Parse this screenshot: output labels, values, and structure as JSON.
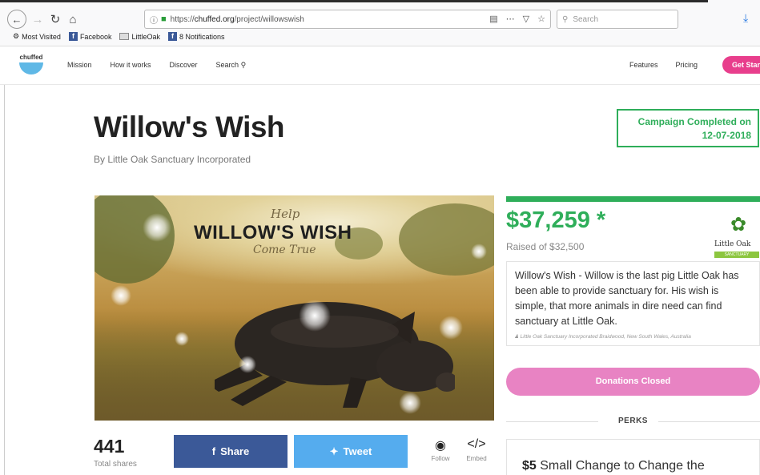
{
  "browser": {
    "url_protocol": "https://",
    "url_host": "chuffed.org",
    "url_path": "/project/willowswish",
    "search_placeholder": "Search",
    "bookmarks": [
      {
        "label": "Most Visited",
        "icon": "gear-icon"
      },
      {
        "label": "Facebook",
        "icon": "facebook-icon"
      },
      {
        "label": "LittleOak",
        "icon": "folder-icon"
      },
      {
        "label": "8 Notifications",
        "icon": "facebook-icon"
      }
    ]
  },
  "site_nav": {
    "logo_text": "chuffed",
    "links": [
      "Mission",
      "How it works",
      "Discover",
      "Search"
    ],
    "right_links": [
      "Features",
      "Pricing"
    ],
    "cta": "Get Start"
  },
  "campaign": {
    "title": "Willow's Wish",
    "byline": "By Little Oak Sanctuary Incorporated",
    "status_line1": "Campaign Completed on",
    "status_line2": "12-07-2018",
    "hero_help": "Help",
    "hero_title": "WILLOW'S WISH",
    "hero_sub": "Come True",
    "raised": "$37,259 *",
    "target": "Raised of $32,500",
    "progress": 1.0,
    "org_logo_name": "Little Oak",
    "org_logo_band": "SANCTUARY",
    "description": "Willow's Wish - Willow is the last pig Little Oak has been able to provide sanctuary for. His wish is simple, that more animals in dire need can find sanctuary at Little Oak.",
    "meta": "Little Oak Sanctuary Incorporated  Braidwood, New South Wales, Australia",
    "donate_label": "Donations Closed",
    "perks_label": "PERKS",
    "perk_amount": "$5",
    "perk_title": "Small Change to Change the"
  },
  "shares": {
    "count": "441",
    "label": "Total shares",
    "share_label": "Share",
    "tweet_label": "Tweet",
    "follow_label": "Follow",
    "embed_label": "Embed"
  },
  "colors": {
    "brand_green": "#2fae5a",
    "facebook_blue": "#3b5998",
    "twitter_blue": "#55acee",
    "pink": "#e83e8c",
    "donate_pink": "#e883c3"
  }
}
